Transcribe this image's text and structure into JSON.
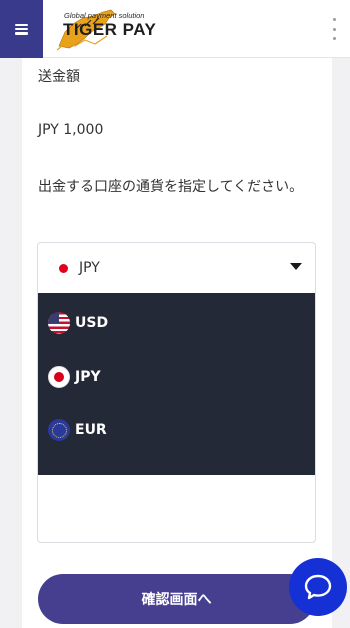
{
  "header": {
    "menu_icon": "hamburger-icon",
    "logo": {
      "tagline": "Global payment solution",
      "brand": "TIGER PAY"
    },
    "more_icon": "kebab-icon"
  },
  "form": {
    "amount_label": "送金額",
    "amount_value": "JPY 1,000",
    "instruction": "出金する口座の通貨を指定してください。",
    "currency_select": {
      "selected": "JPY",
      "options": [
        {
          "label": "USD",
          "icon": "us-flag-icon"
        },
        {
          "label": "JPY",
          "icon": "jp-flag-icon"
        },
        {
          "label": "EUR",
          "icon": "eu-flag-icon"
        }
      ]
    },
    "confirm_label": "確認画面へ"
  },
  "chat": {
    "icon": "chat-bubble-icon"
  },
  "colors": {
    "menu_bg": "#3a3a8c",
    "dropdown_bg": "#232937",
    "confirm_bg": "#463e8f",
    "chat_bg": "#1531d6"
  }
}
